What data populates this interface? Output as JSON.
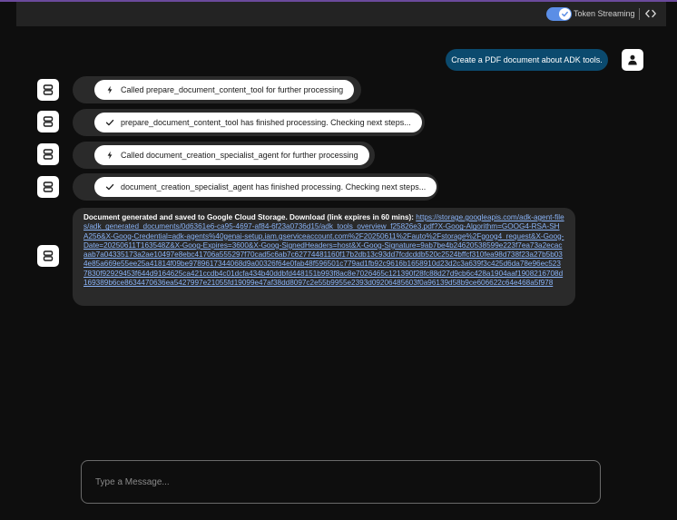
{
  "header": {
    "token_streaming_label": "Token Streaming",
    "token_streaming_on": true,
    "code_icon": "code-brackets-icon"
  },
  "user_message": {
    "text": "Create a PDF document about ADK tools.",
    "avatar_icon": "person-icon"
  },
  "events": [
    {
      "icon": "bolt-icon",
      "text": "Called prepare_document_content_tool for further processing"
    },
    {
      "icon": "check-icon",
      "text": "prepare_document_content_tool has finished processing. Checking next steps..."
    },
    {
      "icon": "bolt-icon",
      "text": "Called document_creation_specialist_agent for further processing"
    },
    {
      "icon": "check-icon",
      "text": "document_creation_specialist_agent has finished processing. Checking next steps..."
    }
  ],
  "result": {
    "text": "Document generated and saved to Google Cloud Storage. Download (link expires in 60 mins): ",
    "link": "https://storage.googleapis.com/adk-agent-files/adk_generated_documents/0d6361e6-ca95-4697-af84-6f23a0736d15/adk_tools_overview_f25826e3.pdf?X-Goog-Algorithm=GOOG4-RSA-SHA256&X-Goog-Credential=adk-agents%40genai-setup.iam.gserviceaccount.com%2F20250611%2Fauto%2Fstorage%2Fgoog4_request&X-Goog-Date=20250611T163548Z&X-Goog-Expires=3600&X-Goog-SignedHeaders=host&X-Goog-Signature=9ab7be4b24620538599e223f7ea73a2ecacaab7a04335173a2ae10497e8ebc41706a555297f70cad5c6ab7c62774481160f17b2db13c93dd7fcdcddb520c2524bffcf310fea98d738f23a27b5b034e85a669e55ee25a41814f09be9789617344068d9a00326f64e0fab48f596501c779ad1fb92c9616b1658910d23d2c3a639f3c425d6da78e96ec5237830f92929453f644d9164625ca421ccdb4c01dcfa434b40ddbfd448151b993f8ac8e7026465c121390f28fc88d27d9cb6c428a1904aaf1908216708d169389b6ce8634470636ea5427997e21055fd19099e47af38dd8097c2e55b9955e2393d09206485603f0a96139d58b9ce606622c64e468a5f978"
  },
  "input": {
    "placeholder": "Type a Message..."
  },
  "colors": {
    "accent": "#5b8ee6",
    "user_bubble": "#0b4a6e",
    "link": "#8ab4f8",
    "bubble_bg": "#2a2a2a"
  }
}
